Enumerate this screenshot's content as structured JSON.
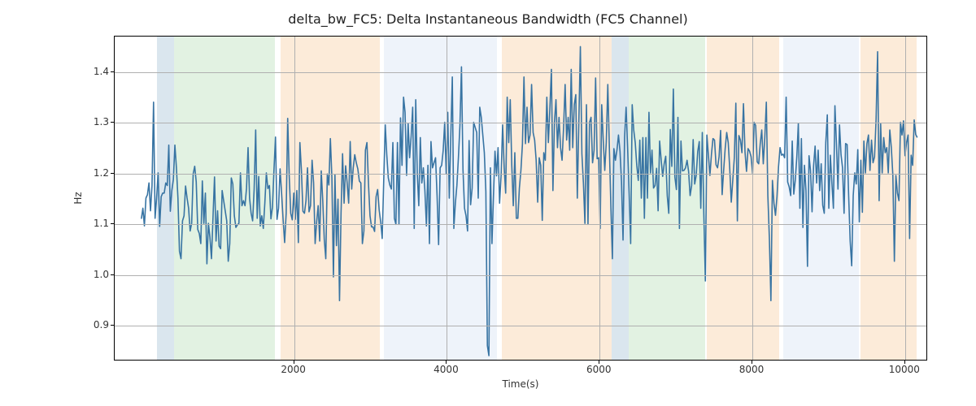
{
  "chart_data": {
    "type": "line",
    "title": "delta_bw_FC5: Delta Instantaneous Bandwidth (FC5 Channel)",
    "xlabel": "Time(s)",
    "ylabel": "Hz",
    "xlim": [
      -350,
      10300
    ],
    "ylim": [
      0.83,
      1.47
    ],
    "xticks": [
      2000,
      4000,
      6000,
      8000,
      10000
    ],
    "yticks": [
      0.9,
      1.0,
      1.1,
      1.2,
      1.3,
      1.4
    ],
    "grid": true,
    "background_spans": [
      {
        "start": 200,
        "end": 430,
        "color": "blue"
      },
      {
        "start": 430,
        "end": 1750,
        "color": "green"
      },
      {
        "start": 1820,
        "end": 3120,
        "color": "orange"
      },
      {
        "start": 3180,
        "end": 4660,
        "color": "lblue"
      },
      {
        "start": 4720,
        "end": 6160,
        "color": "orange"
      },
      {
        "start": 6160,
        "end": 6380,
        "color": "blue"
      },
      {
        "start": 6380,
        "end": 7380,
        "color": "green"
      },
      {
        "start": 7400,
        "end": 8350,
        "color": "orange"
      },
      {
        "start": 8400,
        "end": 9400,
        "color": "lblue"
      },
      {
        "start": 9420,
        "end": 10150,
        "color": "orange"
      }
    ],
    "line_color": "#3874a3",
    "series": [
      {
        "name": "delta_bw_FC5",
        "x_start": 0,
        "x_step": 20,
        "values": [
          1.109,
          1.13,
          1.095,
          1.15,
          1.157,
          1.18,
          1.125,
          1.175,
          1.34,
          1.11,
          1.15,
          1.2,
          1.094,
          1.153,
          1.16,
          1.16,
          1.18,
          1.175,
          1.255,
          1.124,
          1.165,
          1.187,
          1.255,
          1.21,
          1.15,
          1.045,
          1.03,
          1.105,
          1.115,
          1.174,
          1.15,
          1.13,
          1.085,
          1.1,
          1.198,
          1.213,
          1.182,
          1.088,
          1.08,
          1.06,
          1.184,
          1.1,
          1.16,
          1.02,
          1.1,
          1.072,
          1.03,
          1.112,
          1.192,
          1.065,
          1.125,
          1.055,
          1.05,
          1.165,
          1.145,
          1.125,
          1.105,
          1.025,
          1.06,
          1.19,
          1.178,
          1.115,
          1.092,
          1.097,
          1.1,
          1.2,
          1.135,
          1.145,
          1.135,
          1.17,
          1.25,
          1.15,
          1.12,
          1.105,
          1.168,
          1.285,
          1.11,
          1.193,
          1.095,
          1.115,
          1.09,
          1.14,
          1.2,
          1.169,
          1.175,
          1.109,
          1.132,
          1.206,
          1.271,
          1.108,
          1.13,
          1.208,
          1.16,
          1.107,
          1.062,
          1.12,
          1.308,
          1.194,
          1.12,
          1.107,
          1.16,
          1.108,
          1.165,
          1.062,
          1.26,
          1.205,
          1.124,
          1.12,
          1.145,
          1.21,
          1.123,
          1.135,
          1.225,
          1.18,
          1.06,
          1.103,
          1.135,
          1.065,
          1.204,
          1.145,
          1.068,
          1.03,
          1.198,
          1.176,
          1.268,
          1.19,
          0.994,
          1.196,
          1.056,
          1.148,
          0.947,
          1.12,
          1.238,
          1.14,
          1.214,
          1.18,
          1.14,
          1.262,
          1.168,
          1.21,
          1.236,
          1.22,
          1.208,
          1.184,
          1.18,
          1.06,
          1.085,
          1.245,
          1.26,
          1.178,
          1.115,
          1.093,
          1.093,
          1.084,
          1.153,
          1.167,
          1.127,
          1.103,
          1.07,
          1.185,
          1.295,
          1.236,
          1.19,
          1.176,
          1.168,
          1.26,
          1.11,
          1.098,
          1.26,
          1.098,
          1.309,
          1.215,
          1.35,
          1.32,
          1.195,
          1.298,
          1.23,
          1.273,
          1.33,
          1.09,
          1.345,
          1.2,
          1.135,
          1.27,
          1.18,
          1.21,
          1.165,
          1.095,
          1.215,
          1.06,
          1.262,
          1.21,
          1.22,
          1.23,
          1.155,
          1.058,
          1.21,
          1.215,
          1.244,
          1.3,
          1.198,
          1.32,
          1.15,
          1.272,
          1.39,
          1.09,
          1.14,
          1.175,
          1.23,
          1.294,
          1.41,
          1.206,
          1.13,
          1.115,
          1.085,
          1.264,
          1.137,
          1.17,
          1.3,
          1.29,
          1.28,
          1.15,
          1.33,
          1.31,
          1.275,
          1.24,
          1.163,
          0.858,
          0.838,
          1.21,
          1.06,
          1.155,
          1.243,
          1.194,
          1.25,
          1.14,
          1.195,
          1.295,
          1.212,
          1.16,
          1.35,
          1.26,
          1.345,
          1.215,
          1.135,
          1.24,
          1.11,
          1.11,
          1.17,
          1.205,
          1.257,
          1.39,
          1.258,
          1.33,
          1.26,
          1.275,
          1.375,
          1.28,
          1.265,
          1.225,
          1.142,
          1.23,
          1.215,
          1.106,
          1.24,
          1.225,
          1.35,
          1.26,
          1.328,
          1.405,
          1.165,
          1.3,
          1.345,
          1.25,
          1.31,
          1.25,
          1.225,
          1.29,
          1.375,
          1.265,
          1.31,
          1.245,
          1.405,
          1.25,
          1.335,
          1.355,
          1.15,
          1.3,
          1.45,
          1.238,
          1.18,
          1.1,
          1.335,
          1.098,
          1.3,
          1.31,
          1.22,
          1.245,
          1.388,
          1.228,
          1.23,
          1.09,
          1.335,
          1.265,
          1.205,
          1.26,
          1.375,
          1.253,
          1.135,
          1.03,
          1.248,
          1.225,
          1.245,
          1.275,
          1.243,
          1.182,
          1.067,
          1.27,
          1.33,
          1.25,
          1.159,
          1.06,
          1.335,
          1.285,
          1.26,
          1.215,
          1.185,
          1.265,
          1.15,
          1.27,
          1.11,
          1.27,
          1.15,
          1.32,
          1.2,
          1.245,
          1.17,
          1.175,
          1.209,
          1.125,
          1.263,
          1.226,
          1.193,
          1.218,
          1.233,
          1.155,
          1.12,
          1.286,
          1.213,
          1.366,
          1.192,
          1.167,
          1.31,
          1.09,
          1.263,
          1.204,
          1.205,
          1.21,
          1.225,
          1.203,
          1.155,
          1.175,
          1.266,
          1.178,
          1.195,
          1.242,
          1.262,
          1.13,
          1.28,
          1.118,
          0.986,
          1.275,
          1.235,
          1.195,
          1.237,
          1.268,
          1.265,
          1.216,
          1.21,
          1.232,
          1.284,
          1.157,
          1.205,
          1.248,
          1.28,
          1.26,
          1.208,
          1.142,
          1.186,
          1.23,
          1.338,
          1.105,
          1.274,
          1.265,
          1.24,
          1.337,
          1.242,
          1.203,
          1.248,
          1.243,
          1.232,
          1.199,
          1.3,
          1.294,
          1.222,
          1.218,
          1.258,
          1.285,
          1.218,
          1.27,
          1.34,
          1.155,
          1.07,
          0.947,
          1.185,
          1.14,
          1.116,
          1.153,
          1.212,
          1.25,
          1.235,
          1.237,
          1.23,
          1.35,
          1.182,
          1.172,
          1.155,
          1.263,
          1.158,
          1.186,
          1.232,
          1.298,
          1.13,
          1.268,
          1.092,
          1.215,
          1.165,
          1.015,
          1.234,
          1.204,
          1.123,
          1.214,
          1.253,
          1.18,
          1.245,
          1.165,
          1.218,
          1.136,
          1.12,
          1.26,
          1.315,
          1.13,
          1.235,
          1.18,
          1.13,
          1.333,
          1.258,
          1.168,
          1.295,
          1.236,
          1.21,
          1.12,
          1.258,
          1.256,
          1.155,
          1.065,
          1.016,
          1.155,
          1.2,
          1.178,
          1.246,
          1.103,
          1.225,
          1.122,
          1.263,
          1.2,
          1.258,
          1.275,
          1.205,
          1.265,
          1.22,
          1.232,
          1.306,
          1.44,
          1.145,
          1.297,
          1.2,
          1.27,
          1.24,
          1.25,
          1.2,
          1.285,
          1.25,
          1.195,
          1.025,
          1.195,
          1.16,
          1.145,
          1.3,
          1.275,
          1.303,
          1.234,
          1.26,
          1.275,
          1.07,
          1.235,
          1.215,
          1.305,
          1.276,
          1.27
        ]
      }
    ]
  }
}
